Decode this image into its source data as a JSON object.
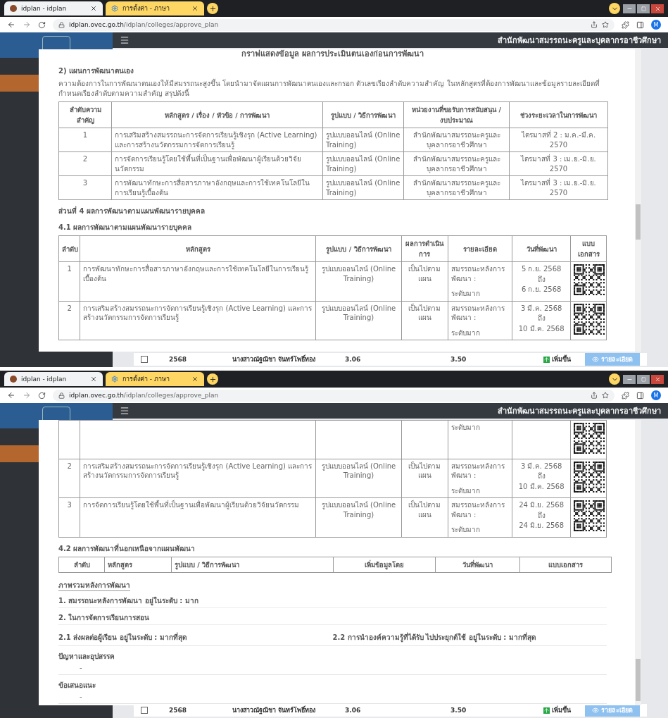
{
  "screens": [
    {
      "tabs": [
        {
          "title": "idplan - idplan",
          "selected": true
        },
        {
          "title": "การตั้งค่า - ภาษา",
          "selected": false
        }
      ],
      "url_host": "idplan.ovec.go.th",
      "url_path": "/idplan/colleges/approve_plan",
      "profile": "M",
      "header_title": "สำนักพัฒนาสมรรถนะครูและบุคลากรอาชีวศึกษา",
      "background_row": {
        "checked": false,
        "year": "2568",
        "name": "นางสาวณัฐณิชา จันทร์โพธิ์ทอง",
        "before": "3.06",
        "after": "3.50",
        "trend": "เพิ่มขึ้น",
        "details": "รายละเอียด"
      },
      "modal": {
        "blocks": [
          {
            "kind": "title",
            "text": "กราฟแสดงข้อมูล ผลการประเมินตนเองก่อนการพัฒนา"
          },
          {
            "kind": "subheading",
            "text": "2) แผนการพัฒนาตนเอง"
          },
          {
            "kind": "paragraph",
            "text": "ความต้องการในการพัฒนาตนเองให้มีสมรรถนะสูงขึ้น โดยนำมาจัดแผนการพัฒนาตนเองและกรอก ตัวเลขเรียงลำดับความสำคัญ ในหลักสูตรที่ต้องการพัฒนาและข้อมูลรายละเอียดที่กำหนดเรียงลำดับตามความสำคัญ สรุปดังนี้"
          },
          {
            "kind": "plan_table",
            "columns": [
              "ลำดับความสำคัญ",
              "หลักสูตร / เรื่อง / หัวข้อ / การพัฒนา",
              "รูปแบบ / วิธีการพัฒนา",
              "หน่วยงานที่ขอรับการสนับสนุน / งบประมาณ",
              "ช่วงระยะเวลาในการพัฒนา"
            ],
            "rows": [
              [
                "1",
                "การเสริมสร้างสมรรถนะการจัดการเรียนรู้เชิงรุก (Active Learning) และการสร้างนวัตกรรมการจัดการเรียนรู้",
                "รูปแบบออนไลน์ (Online Training)",
                "สำนักพัฒนาสมรรถนะครูและบุคลากรอาชีวศึกษา",
                "ไตรมาสที่ 2 : ม.ค.-มี.ค. 2570"
              ],
              [
                "2",
                "การจัดการเรียนรู้โดยใช้พื้นที่เป็นฐานเพื่อพัฒนาผู้เรียนด้วยวิจัยนวัตกรรม",
                "รูปแบบออนไลน์ (Online Training)",
                "สำนักพัฒนาสมรรถนะครูและบุคลากรอาชีวศึกษา",
                "ไตรมาสที่ 3 : เม.ย.-มิ.ย. 2570"
              ],
              [
                "3",
                "การพัฒนาทักษะการสื่อสารภาษาอังกฤษและการใช้เทคโนโลยีในการเรียนรู้เบื้องต้น",
                "รูปแบบออนไลน์ (Online Training)",
                "สำนักพัฒนาสมรรถนะครูและบุคลากรอาชีวศึกษา",
                "ไตรมาสที่ 3 : เม.ย.-มิ.ย. 2570"
              ]
            ]
          },
          {
            "kind": "subheading",
            "text": "ส่วนที่ 4 ผลการพัฒนาตามแผนพัฒนารายบุคคล"
          },
          {
            "kind": "subheading",
            "text": "4.1 ผลการพัฒนาตามแผนพัฒนารายบุคคล"
          },
          {
            "kind": "result_table",
            "columns": [
              "ลำดับ",
              "หลักสูตร",
              "รูปแบบ / วิธีการพัฒนา",
              "ผลการดำเนินการ",
              "รายละเอียด",
              "วันที่พัฒนา",
              "แบบเอกสาร"
            ],
            "rows": [
              {
                "kind": "full",
                "no": "1",
                "course": "การพัฒนาทักษะการสื่อสารภาษาอังกฤษและการใช้เทคโนโลยีในการเรียนรู้เบื้องต้น",
                "format": "รูปแบบออนไลน์ (Online Training)",
                "result": "เป็นไปตามแผน",
                "detail": [
                  "สมรรถนะหลังการพัฒนา :",
                  "ระดับมาก"
                ],
                "dates": [
                  "5 ก.ย. 2568",
                  "ถึง",
                  "6 ก.ย. 2568"
                ]
              },
              {
                "kind": "full",
                "no": "2",
                "course": "การเสริมสร้างสมรรถนะการจัดการเรียนรู้เชิงรุก (Active Learning) และการสร้างนวัตกรรมการจัดการเรียนรู้",
                "format": "รูปแบบออนไลน์ (Online Training)",
                "result": "เป็นไปตามแผน",
                "detail": [
                  "สมรรถนะหลังการพัฒนา :",
                  "ระดับมาก"
                ],
                "dates": [
                  "3 มี.ค. 2568",
                  "ถึง",
                  "10 มี.ค. 2568"
                ]
              }
            ]
          }
        ]
      }
    },
    {
      "tabs": [
        {
          "title": "idplan - idplan",
          "selected": true
        },
        {
          "title": "การตั้งค่า - ภาษา",
          "selected": false
        }
      ],
      "url_host": "idplan.ovec.go.th",
      "url_path": "/idplan/colleges/approve_plan",
      "profile": "M",
      "header_title": "สำนักพัฒนาสมรรถนะครูและบุคลากรอาชีวศึกษา",
      "background_row": {
        "checked": false,
        "year": "2568",
        "name": "นางสาวณัฐณิชา จันทร์โพธิ์ทอง",
        "before": "3.06",
        "after": "3.50",
        "trend": "เพิ่มขึ้น",
        "details": "รายละเอียด"
      },
      "modal": {
        "blocks": [
          {
            "kind": "result_table",
            "rows": [
              {
                "kind": "tail",
                "detail": [
                  "ระดับมาก"
                ]
              },
              {
                "kind": "full",
                "no": "2",
                "course": "การเสริมสร้างสมรรถนะการจัดการเรียนรู้เชิงรุก (Active Learning) และการสร้างนวัตกรรมการจัดการเรียนรู้",
                "format": "รูปแบบออนไลน์ (Online Training)",
                "result": "เป็นไปตามแผน",
                "detail": [
                  "สมรรถนะหลังการพัฒนา :",
                  "ระดับมาก"
                ],
                "dates": [
                  "3 มี.ค. 2568",
                  "ถึง",
                  "10 มี.ค. 2568"
                ]
              },
              {
                "kind": "full",
                "no": "3",
                "course": "การจัดการเรียนรู้โดยใช้พื้นที่เป็นฐานเพื่อพัฒนาผู้เรียนด้วยวิจัยนวัตกรรม",
                "format": "รูปแบบออนไลน์ (Online Training)",
                "result": "เป็นไปตามแผน",
                "detail": [
                  "สมรรถนะหลังการพัฒนา :",
                  "ระดับมาก"
                ],
                "dates": [
                  "24 มิ.ย. 2568",
                  "ถึง",
                  "24 มิ.ย. 2568"
                ]
              }
            ]
          },
          {
            "kind": "subheading",
            "text": "4.2 ผลการพัฒนาที่นอกเหนือจากแผนพัฒนา"
          },
          {
            "kind": "extra_table",
            "columns": [
              "ลำดับ",
              "หลักสูตร",
              "รูปแบบ / วิธีการพัฒนา",
              "เพิ่มข้อมูลโดย",
              "วันที่พัฒนา",
              "แบบเอกสาร"
            ]
          },
          {
            "kind": "overview_heading",
            "text": "ภาพรวมหลังการพัฒนา"
          },
          {
            "kind": "line",
            "text": "1. สมรรถนะหลังการพัฒนา อยู่ในระดับ : มาก"
          },
          {
            "kind": "line",
            "text": "2. ในการจัดการเรียนการสอน"
          },
          {
            "kind": "pair",
            "texts": [
              "2.1 ส่งผลต่อผู้เรียน อยู่ในระดับ : มากที่สุด",
              "2.2 การนำองค์ความรู้ที่ได้รับ ไปประยุกต์ใช้ อยู่ในระดับ : มากที่สุด"
            ]
          },
          {
            "kind": "labeled",
            "label": "ปัญหาและอุปสรรค",
            "value": "-"
          },
          {
            "kind": "labeled",
            "label": "ข้อเสนอแนะ",
            "value": "-"
          }
        ]
      }
    }
  ]
}
